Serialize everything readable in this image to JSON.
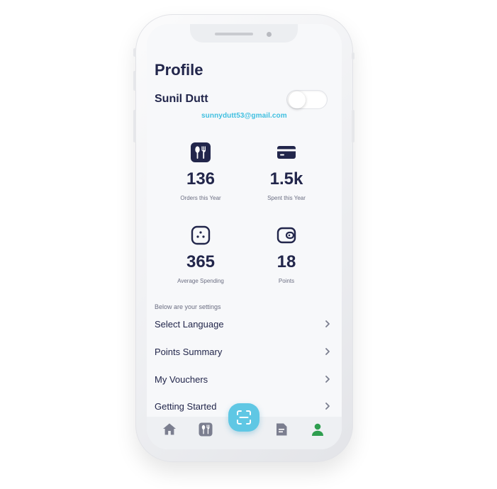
{
  "screen": {
    "title": "Profile",
    "user": {
      "name": "Sunil Dutt",
      "email": "sunnydutt53@gmail.com"
    },
    "dark_mode_toggle": {
      "enabled": false,
      "icon": "moon-icon"
    },
    "stats": [
      {
        "icon": "utensils-icon",
        "value": "136",
        "label": "Orders this Year"
      },
      {
        "icon": "credit-card-icon",
        "value": "1.5k",
        "label": "Spent this Year"
      },
      {
        "icon": "average-icon",
        "value": "365",
        "label": "Average Spending"
      },
      {
        "icon": "wallet-icon",
        "value": "18",
        "label": "Points"
      }
    ],
    "settings_hint": "Below are your settings",
    "settings": [
      {
        "label": "Select Language",
        "icon": "chevron-right-icon"
      },
      {
        "label": "Points Summary",
        "icon": "chevron-right-icon"
      },
      {
        "label": "My Vouchers",
        "icon": "chevron-right-icon"
      },
      {
        "label": "Getting Started",
        "icon": "chevron-right-icon"
      }
    ]
  },
  "tabbar": {
    "items": [
      {
        "icon": "home-icon",
        "active": false
      },
      {
        "icon": "utensils-icon",
        "active": false
      },
      {
        "icon": "scan-icon",
        "active": false
      },
      {
        "icon": "document-icon",
        "active": false
      },
      {
        "icon": "user-icon",
        "active": true
      }
    ]
  },
  "colors": {
    "primary": "#22264b",
    "accent": "#3fbfe0",
    "scan_button": "#5fc7e4",
    "active_tab": "#2e9e4f",
    "inactive_tab": "#7b7e8f"
  }
}
